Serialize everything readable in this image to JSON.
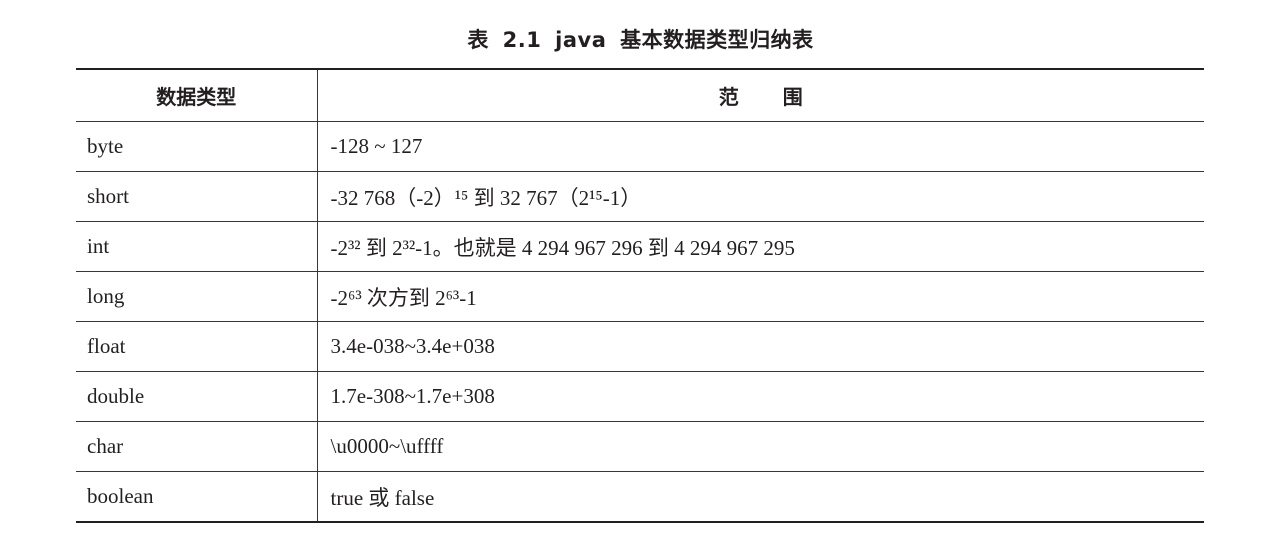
{
  "caption": "表 2.1   java 基本数据类型归纳表",
  "table": {
    "headers": [
      "数据类型",
      "范围"
    ],
    "rows": [
      {
        "type": "byte",
        "range": "-128 ~ 127"
      },
      {
        "type": "short",
        "range": "-32 768（-2）¹⁵ 到 32 767（2¹⁵-1）"
      },
      {
        "type": "int",
        "range": "-2³² 到 2³²-1。也就是 4 294 967 296 到 4 294 967 295"
      },
      {
        "type": "long",
        "range": "-2⁶³ 次方到 2⁶³-1"
      },
      {
        "type": "float",
        "range": "3.4e-038~3.4e+038"
      },
      {
        "type": "double",
        "range": "1.7e-308~1.7e+308"
      },
      {
        "type": "char",
        "range": "\\u0000~\\uffff"
      },
      {
        "type": "boolean",
        "range": "true 或 false"
      }
    ]
  }
}
